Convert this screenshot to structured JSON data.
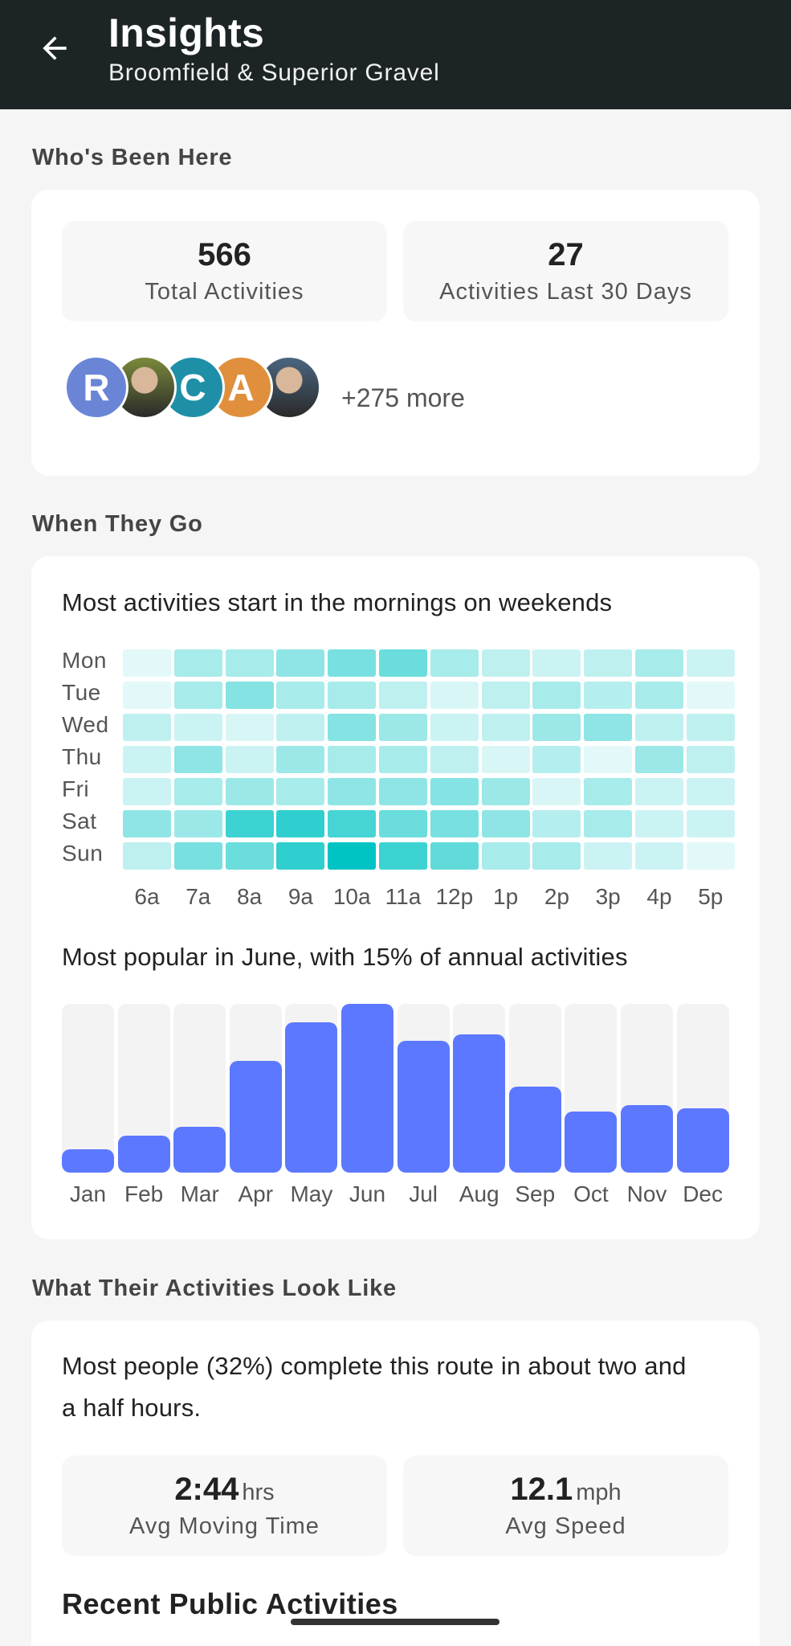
{
  "header": {
    "title": "Insights",
    "subtitle": "Broomfield & Superior Gravel"
  },
  "whos_been_here": {
    "section_label": "Who's Been Here",
    "stats": [
      {
        "value": "566",
        "label": "Total Activities"
      },
      {
        "value": "27",
        "label": "Activities Last 30 Days"
      }
    ],
    "avatars": [
      {
        "kind": "letter",
        "letter": "R",
        "color": "#6a85d6"
      },
      {
        "kind": "photo",
        "letter": "",
        "color": "#7a8a3a"
      },
      {
        "kind": "letter",
        "letter": "C",
        "color": "#1f8fa8"
      },
      {
        "kind": "letter",
        "letter": "A",
        "color": "#e08f3c"
      },
      {
        "kind": "photo",
        "letter": "",
        "color": "#4a6680"
      }
    ],
    "more_text": "+275 more"
  },
  "when_they_go": {
    "section_label": "When They Go",
    "heatmap_caption": "Most activities start in the mornings on weekends",
    "days": [
      "Mon",
      "Tue",
      "Wed",
      "Thu",
      "Fri",
      "Sat",
      "Sun"
    ],
    "hours": [
      "6a",
      "7a",
      "8a",
      "9a",
      "10a",
      "11a",
      "12p",
      "1p",
      "2p",
      "3p",
      "4p",
      "5p"
    ],
    "heat_levels": [
      [
        0.05,
        0.3,
        0.3,
        0.4,
        0.5,
        0.55,
        0.3,
        0.2,
        0.15,
        0.2,
        0.3,
        0.15
      ],
      [
        0.05,
        0.3,
        0.45,
        0.3,
        0.3,
        0.2,
        0.1,
        0.2,
        0.3,
        0.25,
        0.3,
        0.05
      ],
      [
        0.2,
        0.15,
        0.1,
        0.2,
        0.45,
        0.35,
        0.15,
        0.2,
        0.35,
        0.4,
        0.2,
        0.2
      ],
      [
        0.15,
        0.4,
        0.15,
        0.35,
        0.3,
        0.3,
        0.2,
        0.1,
        0.25,
        0.05,
        0.35,
        0.2
      ],
      [
        0.15,
        0.3,
        0.35,
        0.3,
        0.4,
        0.4,
        0.45,
        0.35,
        0.1,
        0.3,
        0.15,
        0.15
      ],
      [
        0.4,
        0.35,
        0.75,
        0.8,
        0.7,
        0.55,
        0.5,
        0.4,
        0.25,
        0.3,
        0.15,
        0.15
      ],
      [
        0.2,
        0.5,
        0.55,
        0.8,
        1.0,
        0.75,
        0.6,
        0.3,
        0.3,
        0.15,
        0.15,
        0.05
      ]
    ],
    "bar_caption": "Most popular in June, with 15% of annual activities",
    "chart_data": {
      "type": "bar",
      "categories": [
        "Jan",
        "Feb",
        "Mar",
        "Apr",
        "May",
        "Jun",
        "Jul",
        "Aug",
        "Sep",
        "Oct",
        "Nov",
        "Dec"
      ],
      "values": [
        14,
        22,
        27,
        66,
        89,
        100,
        78,
        82,
        51,
        36,
        40,
        38
      ],
      "ylim": [
        0,
        100
      ],
      "bar_color": "#5c78ff",
      "track_color": "#f3f3f3"
    }
  },
  "activities": {
    "section_label": "What Their Activities Look Like",
    "description_line1": "Most people (32%) complete this route in about two and",
    "description_line2": "a half hours.",
    "stats": [
      {
        "value": "2:44",
        "unit": "hrs",
        "label": "Avg Moving Time"
      },
      {
        "value": "12.1",
        "unit": "mph",
        "label": "Avg Speed"
      }
    ],
    "recent_title": "Recent Public Activities"
  },
  "colors": {
    "header_bg": "#1c2426",
    "heat_base": "#00c4c4"
  }
}
